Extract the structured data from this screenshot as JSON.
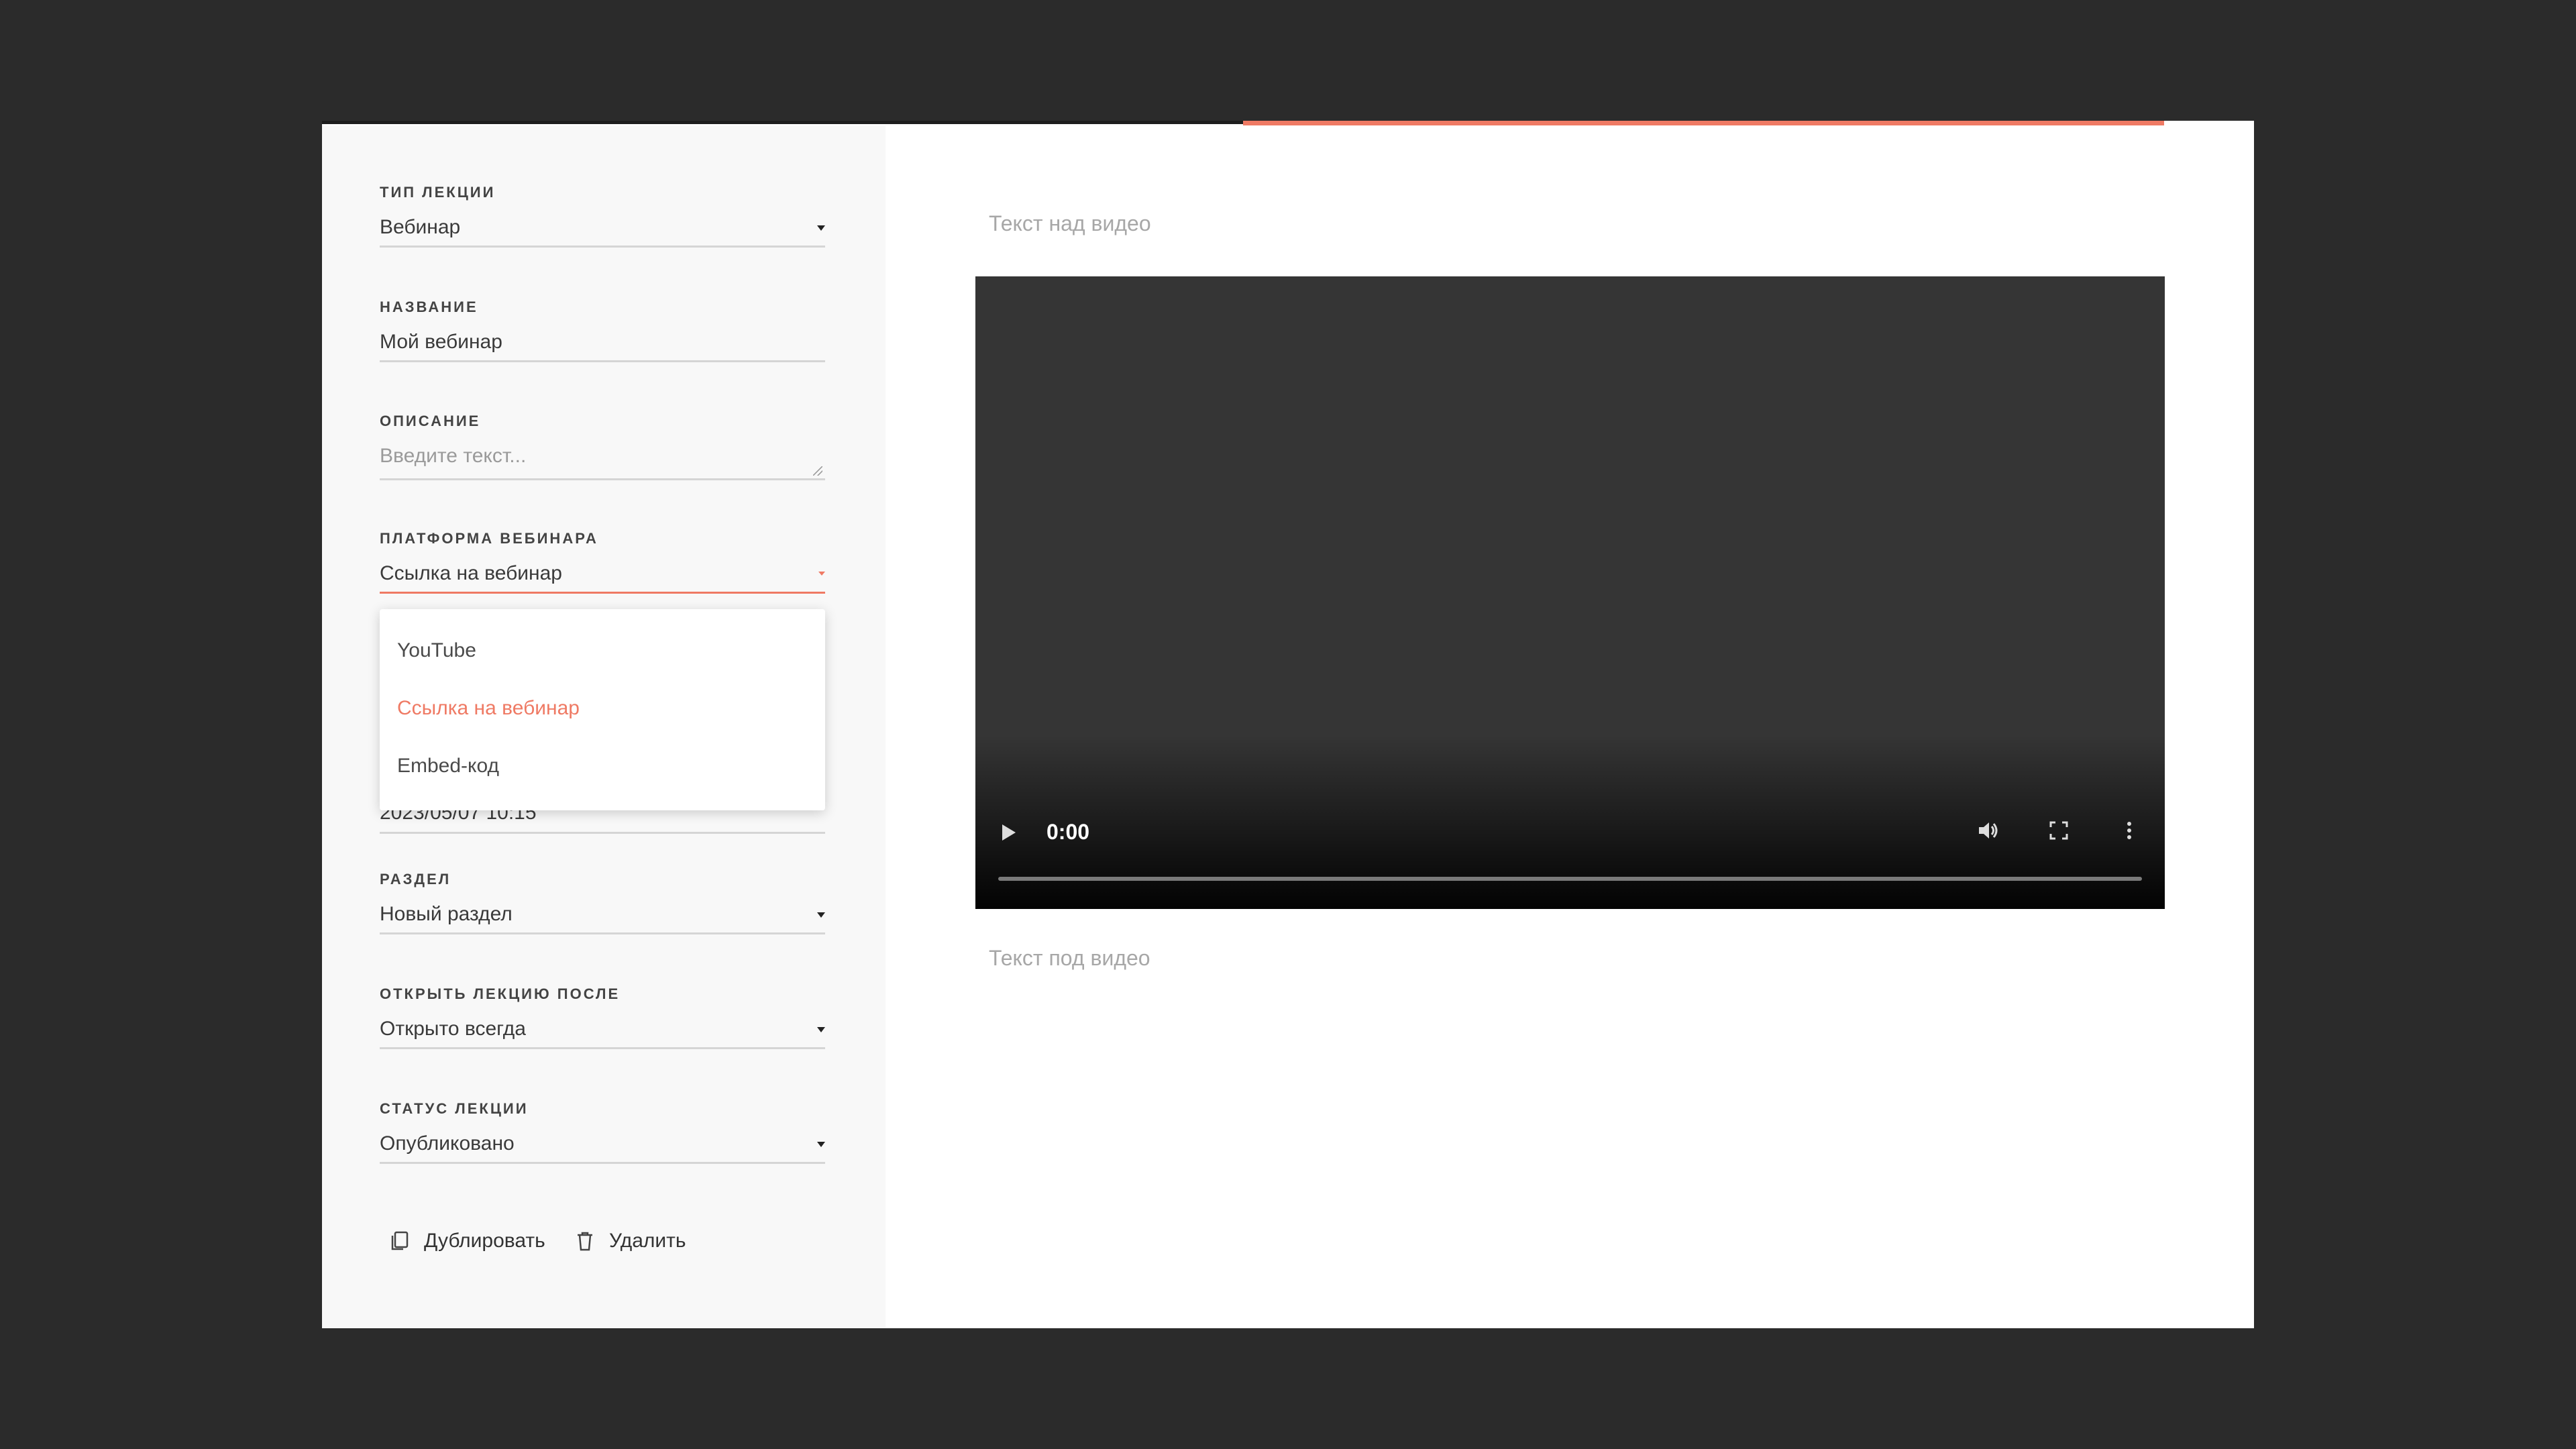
{
  "form": {
    "lecture_type": {
      "label": "Тип лекции",
      "value": "Вебинар"
    },
    "name": {
      "label": "Название",
      "value": "Мой вебинар"
    },
    "description": {
      "label": "Описание",
      "placeholder": "Введите текст..."
    },
    "platform": {
      "label": "Платформа вебинара",
      "value": "Ссылка на вебинар"
    },
    "hidden_date_partial": "2023/05/07 10:15",
    "section": {
      "label": "Раздел",
      "value": "Новый раздел"
    },
    "open_after": {
      "label": "Открыть лекцию после",
      "value": "Открыто всегда"
    },
    "status": {
      "label": "Статус лекции",
      "value": "Опубликовано"
    }
  },
  "dropdown": {
    "items": [
      "YouTube",
      "Ссылка на вебинар",
      "Embed-код"
    ],
    "selected_index": 1
  },
  "actions": {
    "duplicate": "Дублировать",
    "delete": "Удалить"
  },
  "preview": {
    "text_above": "Текст над видео",
    "text_below": "Текст под видео",
    "video_time": "0:00"
  },
  "colors": {
    "accent": "#ef7a64",
    "background": "#2b2b2b",
    "video_bg": "#353535"
  },
  "icons": [
    "play-icon",
    "volume-icon",
    "fullscreen-icon",
    "more-vert-icon",
    "copy-icon",
    "trash-icon",
    "dropdown-caret-icon"
  ]
}
